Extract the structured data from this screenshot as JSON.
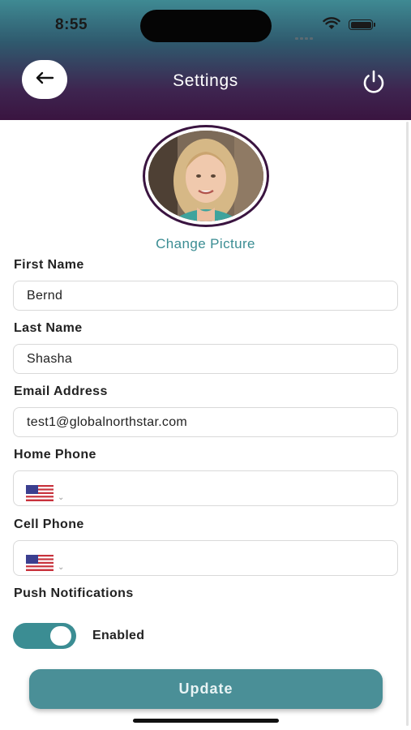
{
  "status_bar": {
    "time": "8:55"
  },
  "header": {
    "title": "Settings"
  },
  "profile": {
    "change_picture_label": "Change Picture"
  },
  "form": {
    "first_name": {
      "label": "First Name",
      "value": "Bernd"
    },
    "last_name": {
      "label": "Last Name",
      "value": "Shasha"
    },
    "email": {
      "label": "Email Address",
      "value": "test1@globalnorthstar.com"
    },
    "home_phone": {
      "label": "Home Phone",
      "country": "US",
      "value": ""
    },
    "cell_phone": {
      "label": "Cell Phone",
      "country": "US",
      "value": ""
    },
    "push_notifications": {
      "label": "Push Notifications",
      "state_label": "Enabled",
      "enabled": true
    }
  },
  "actions": {
    "update_label": "Update"
  },
  "colors": {
    "accent": "#3b8d93",
    "header_dark": "#3a1440",
    "header_light": "#3f8a93"
  }
}
